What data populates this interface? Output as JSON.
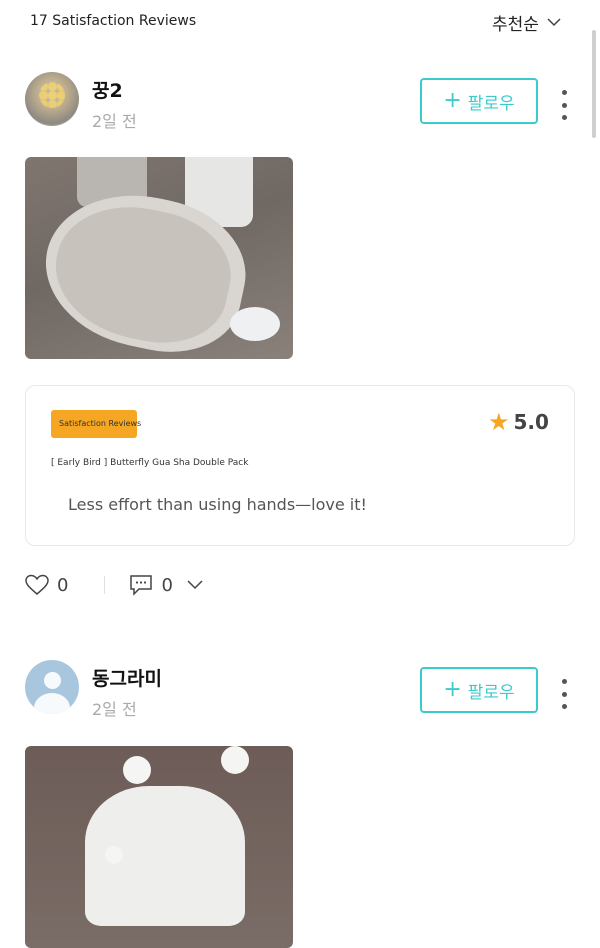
{
  "header": {
    "review_count": "17 Satisfaction Reviews",
    "sort_label": "추천순",
    "sort_icon": "chevron-down-icon"
  },
  "colors": {
    "accent": "#3ccbcc",
    "badge": "#f5a623",
    "star": "#f5a623"
  },
  "reviews": [
    {
      "username": "꿍2",
      "date": "2일 전",
      "follow_label": "팔로우",
      "product": {
        "badge": "Satisfaction Reviews",
        "rating": "5.0",
        "name": "[ Early Bird ] Butterfly Gua Sha Double Pack",
        "text": "Less effort than using hands—love it!"
      },
      "likes": "0",
      "comments": "0"
    },
    {
      "username": "동그라미",
      "date": "2일 전",
      "follow_label": "팔로우"
    }
  ]
}
